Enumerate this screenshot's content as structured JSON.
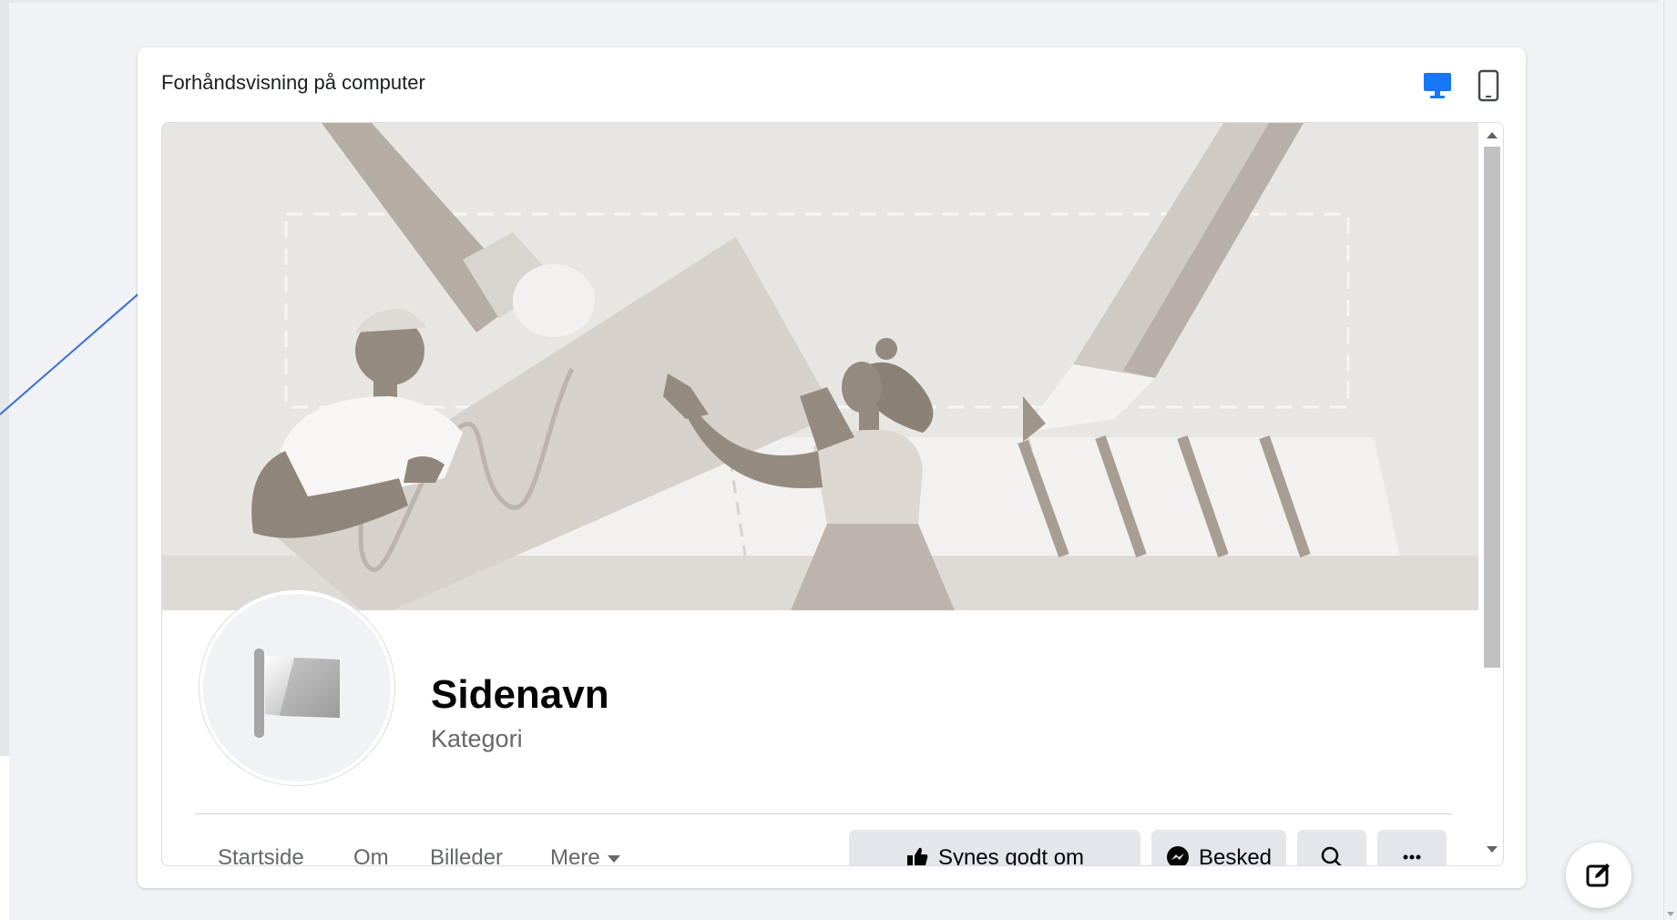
{
  "preview": {
    "title": "Forhåndsvisning på computer",
    "device_options": [
      "desktop-icon",
      "mobile-icon"
    ],
    "active_device": "desktop",
    "accent_color": "#1877f2"
  },
  "page": {
    "name": "Sidenavn",
    "category": "Kategori"
  },
  "tabs": {
    "home": "Startside",
    "about": "Om",
    "photos": "Billeder",
    "more": "Mere"
  },
  "actions": {
    "like": "Synes godt om",
    "message": "Besked"
  },
  "icons": {
    "like_icon": "thumbs-up-icon",
    "message_icon": "messenger-icon",
    "search_icon": "search-icon",
    "more_icon": "more-dots-icon",
    "compose_icon": "compose-icon"
  }
}
